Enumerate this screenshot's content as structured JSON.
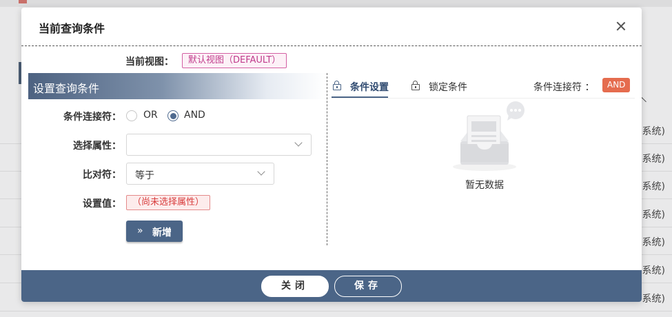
{
  "background": {
    "row_suffix": "系统)",
    "rows": 7
  },
  "dialog": {
    "title": "当前查询条件",
    "current_view_label": "当前视图：",
    "current_view_value": "默认视图（DEFAULT）"
  },
  "left_panel": {
    "title": "设置查询条件",
    "connector_label": "条件连接符：",
    "connector_options": [
      "OR",
      "AND"
    ],
    "connector_selected": "AND",
    "attribute_label": "选择属性：",
    "attribute_value": "",
    "comparator_label": "比对符：",
    "comparator_value": "等于",
    "set_value_label": "设置值：",
    "set_value_placeholder": "（尚未选择属性）",
    "add_button_icon": "»",
    "add_button_label": "新增"
  },
  "right_panel": {
    "tabs": [
      {
        "label": "条件设置",
        "active": true
      },
      {
        "label": "锁定条件",
        "active": false
      }
    ],
    "connector_label": "条件连接符 ：",
    "connector_value": "AND",
    "empty_text": "暂无数据"
  },
  "footer": {
    "close_label": "关闭",
    "save_label": "保存"
  },
  "colors": {
    "primary": "#4b6587",
    "badge": "#e56c4e",
    "view_tag": "#c03c8c",
    "warning_tag": "#d83c3c"
  },
  "icons": {
    "close": "close-icon",
    "tab": "lock-icon",
    "add": "double-chevron-right-icon",
    "empty": "empty-inbox-icon"
  }
}
